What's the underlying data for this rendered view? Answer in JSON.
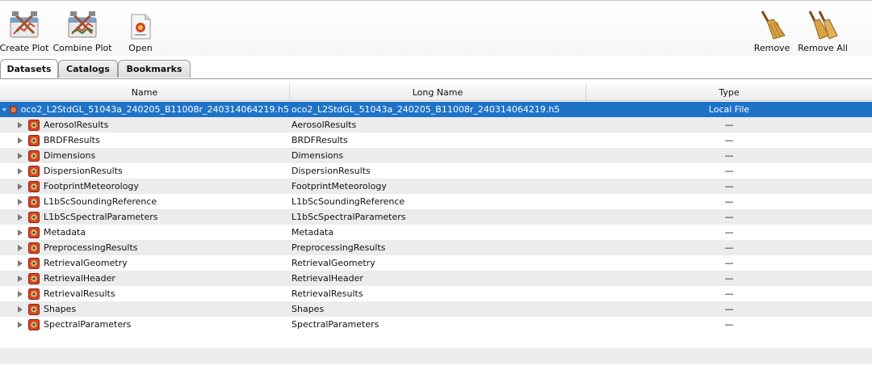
{
  "toolbar": {
    "create_plot": "Create Plot",
    "combine_plot": "Combine Plot",
    "open": "Open",
    "remove": "Remove",
    "remove_all": "Remove All"
  },
  "tabs": [
    {
      "label": "Datasets",
      "active": true
    },
    {
      "label": "Catalogs",
      "active": false
    },
    {
      "label": "Bookmarks",
      "active": false
    }
  ],
  "table": {
    "columns": {
      "name": "Name",
      "long_name": "Long Name",
      "type": "Type"
    },
    "root": {
      "name": "oco2_L2StdGL_51043a_240205_B11008r_240314064219.h5",
      "long_name": "oco2_L2StdGL_51043a_240205_B11008r_240314064219.h5",
      "type": "Local File"
    },
    "children": [
      {
        "name": "AerosolResults",
        "long_name": "AerosolResults",
        "type": "—"
      },
      {
        "name": "BRDFResults",
        "long_name": "BRDFResults",
        "type": "—"
      },
      {
        "name": "Dimensions",
        "long_name": "Dimensions",
        "type": "—"
      },
      {
        "name": "DispersionResults",
        "long_name": "DispersionResults",
        "type": "—"
      },
      {
        "name": "FootprintMeteorology",
        "long_name": "FootprintMeteorology",
        "type": "—"
      },
      {
        "name": "L1bScSoundingReference",
        "long_name": "L1bScSoundingReference",
        "type": "—"
      },
      {
        "name": "L1bScSpectralParameters",
        "long_name": "L1bScSpectralParameters",
        "type": "—"
      },
      {
        "name": "Metadata",
        "long_name": "Metadata",
        "type": "—"
      },
      {
        "name": "PreprocessingResults",
        "long_name": "PreprocessingResults",
        "type": "—"
      },
      {
        "name": "RetrievalGeometry",
        "long_name": "RetrievalGeometry",
        "type": "—"
      },
      {
        "name": "RetrievalHeader",
        "long_name": "RetrievalHeader",
        "type": "—"
      },
      {
        "name": "RetrievalResults",
        "long_name": "RetrievalResults",
        "type": "—"
      },
      {
        "name": "Shapes",
        "long_name": "Shapes",
        "type": "—"
      },
      {
        "name": "SpectralParameters",
        "long_name": "SpectralParameters",
        "type": "—"
      }
    ]
  },
  "colors": {
    "selection": "#1e73c8",
    "alt_row": "#ececec",
    "h5_icon_red": "#d4452a"
  },
  "icons": {
    "create_plot": "create-plot-icon",
    "combine_plot": "combine-plot-icon",
    "open": "open-file-icon",
    "remove": "broom-icon",
    "remove_all": "double-broom-icon",
    "expand": "expand-triangle-icon",
    "collapse": "collapse-triangle-icon",
    "hdf5": "hdf5-icon"
  }
}
